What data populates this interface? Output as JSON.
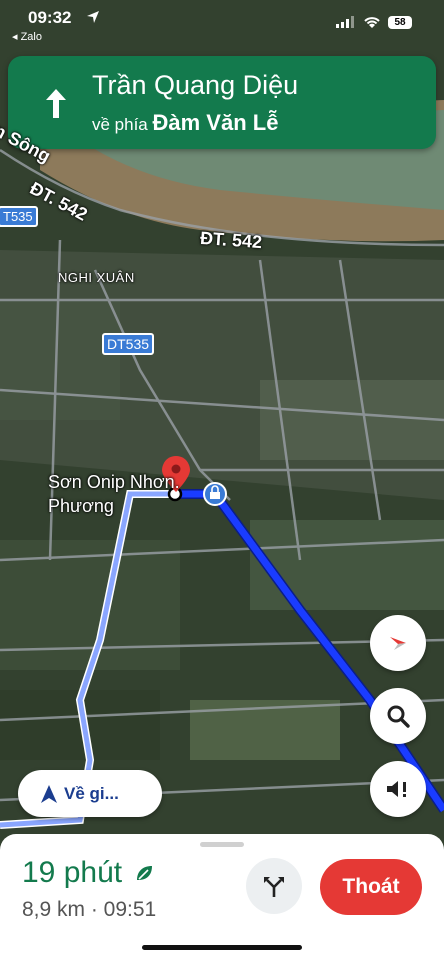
{
  "status_bar": {
    "time": "09:32",
    "back_app": "◂ Zalo",
    "battery": "58"
  },
  "navigation": {
    "street": "Trần Quang Diệu",
    "toward_prefix": "về phía",
    "toward_street": "Đàm Văn Lễ"
  },
  "map": {
    "labels": {
      "road_542_a": "ĐT. 542",
      "road_542_b": "ĐT. 542",
      "road_song": "n Sông",
      "area": "NGHI XUÂN",
      "shield_1": "T535",
      "shield_2": "DT535",
      "poi_line1": "Sơn Onip Nhơn.",
      "poi_line2": "Phương"
    }
  },
  "buttons": {
    "recenter_label": "Về gi..."
  },
  "trip": {
    "duration": "19 phút",
    "summary": "8,9 km · 09:51",
    "exit_label": "Thoát"
  },
  "colors": {
    "route_primary": "#1a3cff",
    "route_secondary": "#8aa6ff",
    "banner": "#137a4d",
    "exit": "#e53935"
  }
}
